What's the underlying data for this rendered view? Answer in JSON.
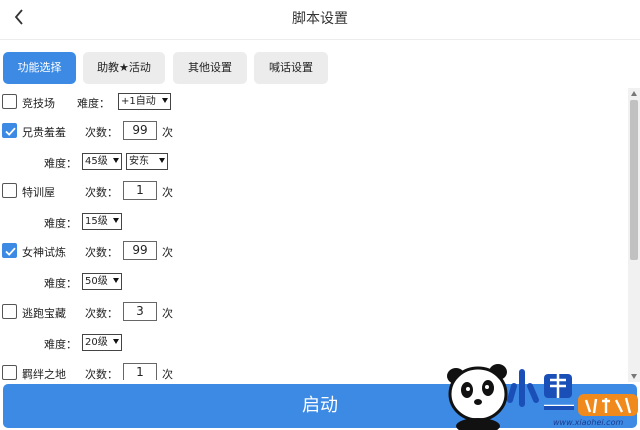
{
  "header": {
    "title": "脚本设置"
  },
  "tabs": [
    {
      "label": "功能选择",
      "active": true
    },
    {
      "label": "助教★活动",
      "active": false
    },
    {
      "label": "其他设置",
      "active": false
    },
    {
      "label": "喊话设置",
      "active": false
    }
  ],
  "rows": [
    {
      "name": "竞技场",
      "checked": false,
      "difficulty_label": "难度：",
      "difficulty": "+1自动"
    },
    {
      "name": "兄贵羞羞",
      "checked": true,
      "count_label": "次数：",
      "count": "99",
      "unit": "次",
      "difficulty_label": "难度：",
      "difficulty": "45级",
      "extra": "安东"
    },
    {
      "name": "特训屋",
      "checked": false,
      "count_label": "次数：",
      "count": "1",
      "unit": "次",
      "difficulty_label": "难度：",
      "difficulty": "15级"
    },
    {
      "name": "女神试炼",
      "checked": true,
      "count_label": "次数：",
      "count": "99",
      "unit": "次",
      "difficulty_label": "难度：",
      "difficulty": "50级"
    },
    {
      "name": "逃跑宝藏",
      "checked": false,
      "count_label": "次数：",
      "count": "3",
      "unit": "次",
      "difficulty_label": "难度：",
      "difficulty": "20级"
    },
    {
      "name": "羁绊之地",
      "checked": false,
      "count_label": "次数：",
      "count": "1",
      "unit": "次"
    }
  ],
  "start_button": {
    "label": "启动"
  },
  "watermark": {
    "site": "www.xiaohei.com",
    "logo_text": "小黑游戏"
  },
  "colors": {
    "accent": "#3d8ae5",
    "tab_bg": "#ececec"
  }
}
